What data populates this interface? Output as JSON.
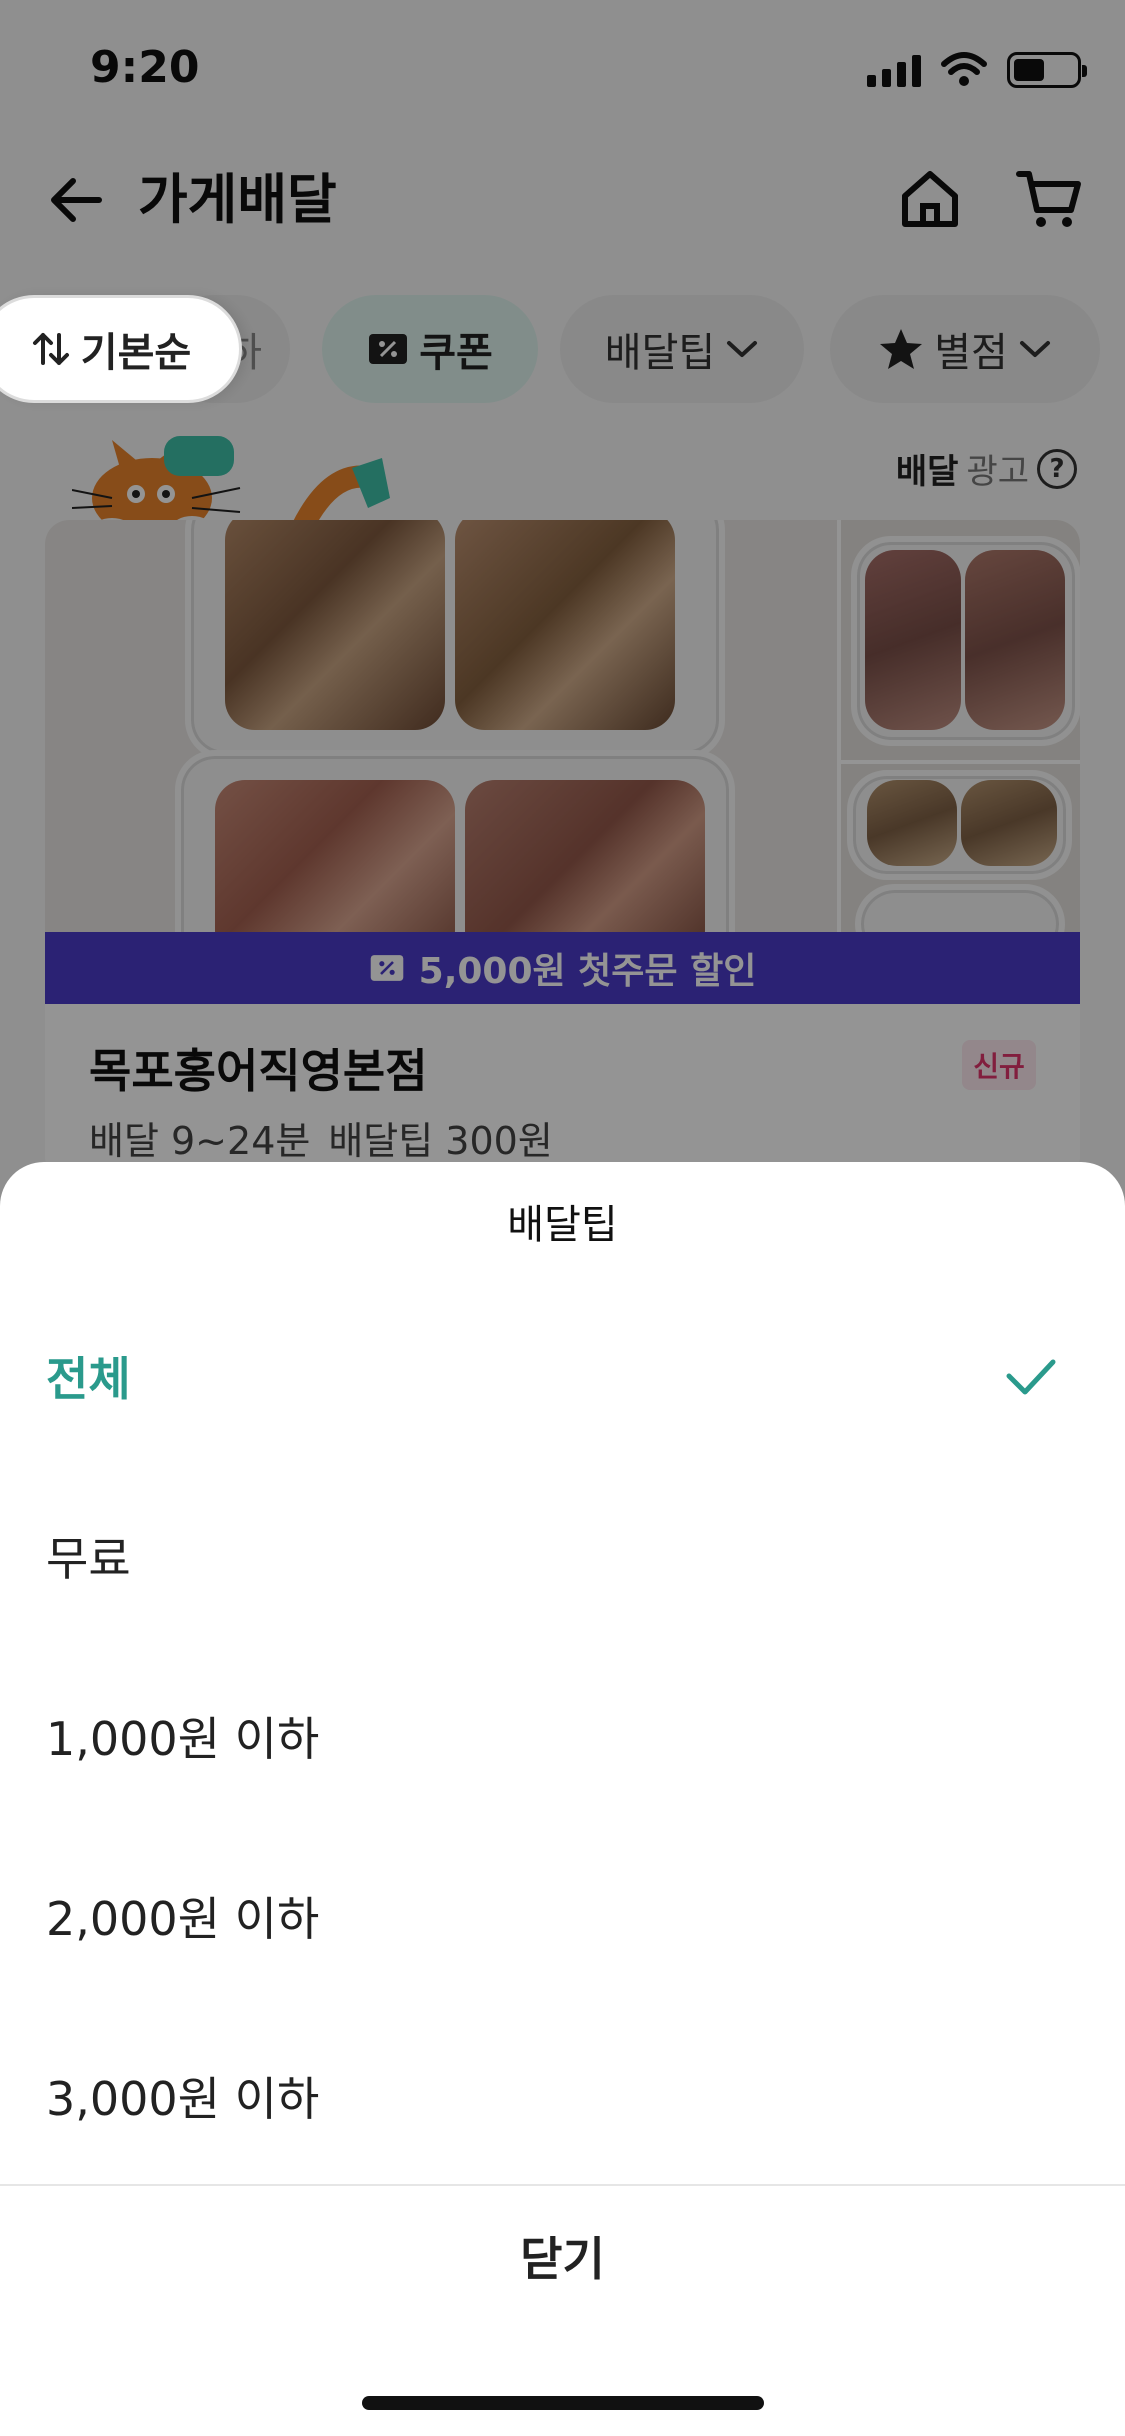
{
  "status_bar": {
    "time": "9:20"
  },
  "header": {
    "title": "가게배달"
  },
  "filters": {
    "sort_label": "기본순",
    "hidden_chip_label": "하",
    "coupon_label": "쿠폰",
    "tip_label": "배달팁",
    "rating_label": "별점"
  },
  "ad": {
    "strong": "배달",
    "light": "광고",
    "help": "?"
  },
  "store": {
    "promo": "5,000원 첫주문 할인",
    "name": "목포홍어직영본점",
    "badge": "신규",
    "delivery_time": "배달 9~24분",
    "delivery_tip": "배달팁 300원"
  },
  "sheet": {
    "title": "배달팁",
    "options": [
      {
        "label": "전체",
        "selected": true
      },
      {
        "label": "무료",
        "selected": false
      },
      {
        "label": "1,000원 이하",
        "selected": false
      },
      {
        "label": "2,000원 이하",
        "selected": false
      },
      {
        "label": "3,000원 이하",
        "selected": false
      }
    ],
    "close_label": "닫기"
  },
  "colors": {
    "accent": "#2a9a8c",
    "promo": "#4b3cc9",
    "badge": "#e0356b"
  }
}
